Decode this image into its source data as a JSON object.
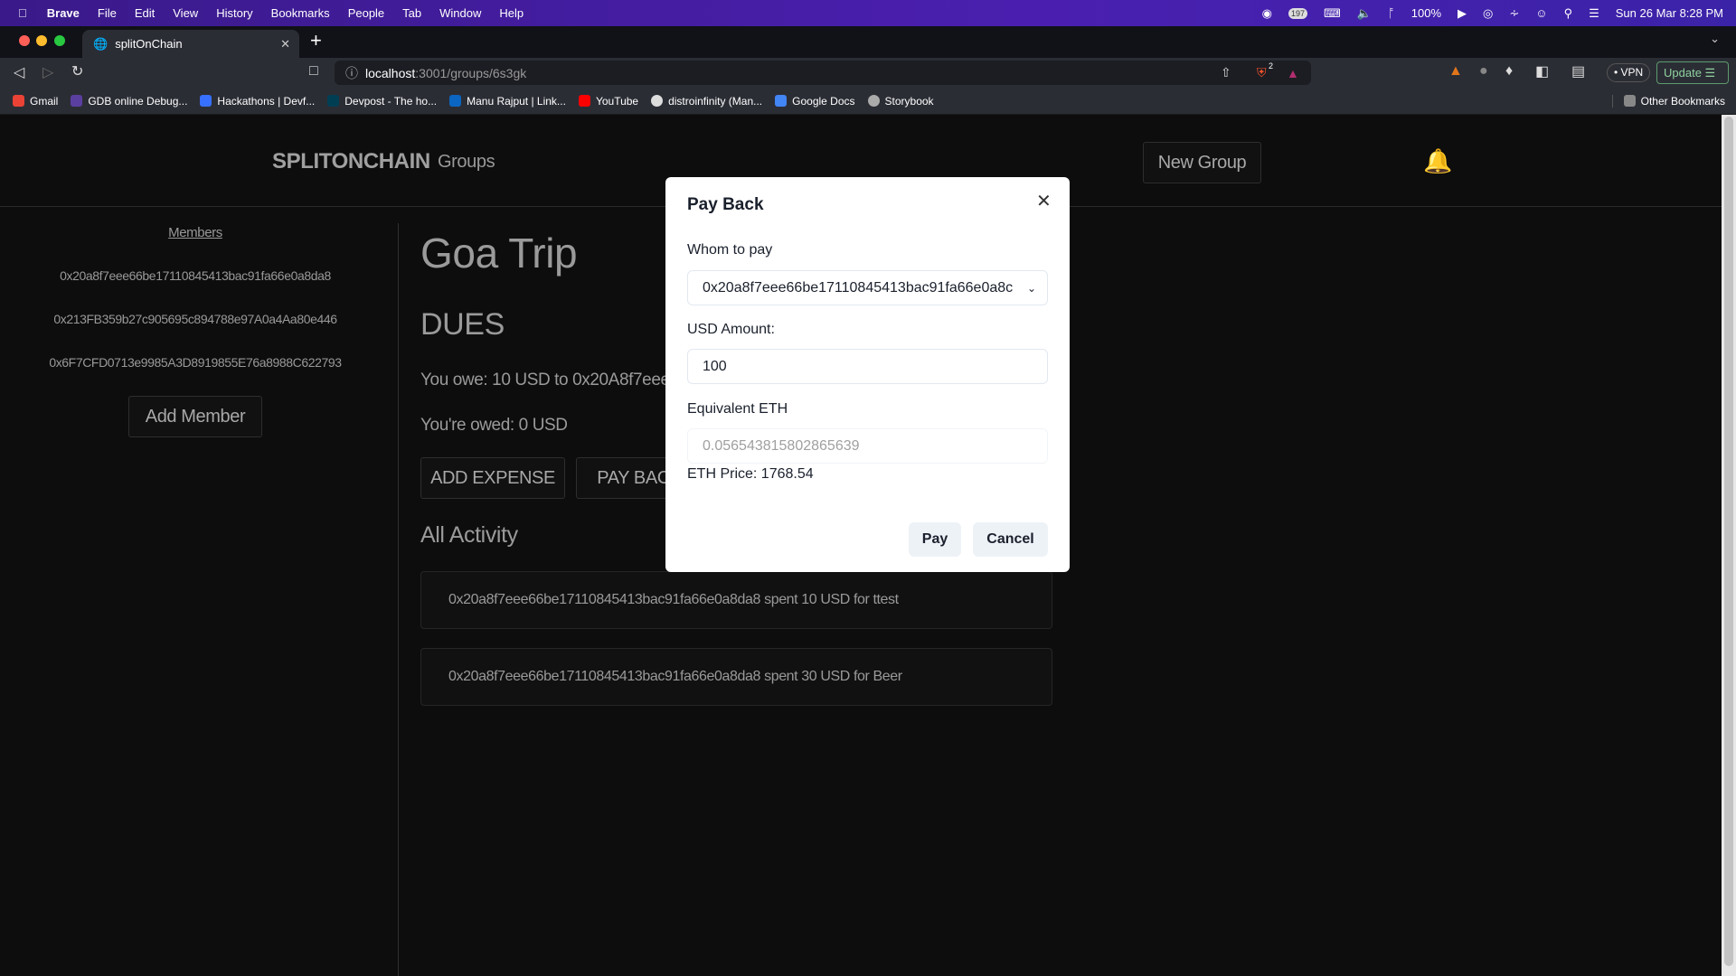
{
  "os_menubar": {
    "app": "Brave",
    "menus": [
      "File",
      "Edit",
      "View",
      "History",
      "Bookmarks",
      "People",
      "Tab",
      "Window",
      "Help"
    ],
    "notification_count": "197",
    "battery": "100%",
    "datetime": "Sun 26 Mar  8:28 PM"
  },
  "browser": {
    "tab_title": "splitOnChain",
    "url_host": "localhost",
    "url_path": ":3001/groups/6s3gk",
    "shields_count": "2",
    "vpn_label": "VPN",
    "update_label": "Update",
    "bookmarks": [
      "Gmail",
      "GDB online Debug...",
      "Hackathons | Devf...",
      "Devpost - The ho...",
      "Manu Rajput | Link...",
      "YouTube",
      "distroinfinity (Man...",
      "Google Docs",
      "Storybook"
    ],
    "other_bookmarks": "Other Bookmarks"
  },
  "navbar": {
    "brand": "SPLITONCHAIN",
    "groups_link": "Groups",
    "new_group": "New Group"
  },
  "sidebar": {
    "members_title": "Members",
    "members": [
      "0x20a8f7eee66be17110845413bac91fa66e0a8da8",
      "0x213FB359b27c905695c894788e97A0a4Aa80e446",
      "0x6F7CFD0713e9985A3D8919855E76a8988C622793"
    ],
    "add_member": "Add Member"
  },
  "main": {
    "group_name": "Goa Trip",
    "dues_title": "DUES",
    "you_owe": "You owe: 10 USD to 0x20A8f7eee6",
    "youre_owed": "You're owed: 0 USD",
    "add_expense": "ADD EXPENSE",
    "pay_back": "PAY BACK",
    "activity_title": "All Activity",
    "activity": [
      "0x20a8f7eee66be17110845413bac91fa66e0a8da8 spent 10 USD for ttest",
      "0x20a8f7eee66be17110845413bac91fa66e0a8da8 spent 30 USD for Beer"
    ]
  },
  "modal": {
    "title": "Pay Back",
    "whom_label": "Whom to pay",
    "whom_value": "0x20a8f7eee66be17110845413bac91fa66e0a8c",
    "usd_label": "USD Amount:",
    "usd_value": "100",
    "eth_label": "Equivalent ETH",
    "eth_value": "0.056543815802865639",
    "eth_price": "ETH Price: 1768.54",
    "pay": "Pay",
    "cancel": "Cancel"
  }
}
